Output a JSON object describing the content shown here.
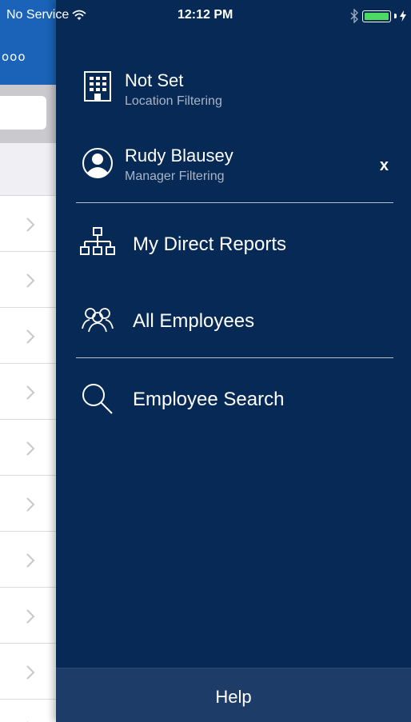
{
  "status_bar": {
    "carrier": "No Service",
    "time": "12:12 PM",
    "battery_level": 1.0
  },
  "background": {
    "navbar_more": "ooo"
  },
  "drawer": {
    "location_filter": {
      "title": "Not Set",
      "subtitle": "Location Filtering",
      "icon": "building-icon"
    },
    "manager_filter": {
      "title": "Rudy Blausey",
      "subtitle": "Manager Filtering",
      "icon": "person-icon",
      "clear_label": "x"
    },
    "menu": [
      {
        "label": "My Direct Reports",
        "icon": "org-chart-icon"
      },
      {
        "label": "All Employees",
        "icon": "people-group-icon"
      },
      {
        "label": "Employee Search",
        "icon": "search-icon"
      }
    ],
    "help_label": "Help"
  },
  "colors": {
    "drawer_background": "#062a55",
    "help_bar": "#1d3c68",
    "navbar_blue": "#1a63b8",
    "battery_green": "#4cd964"
  }
}
